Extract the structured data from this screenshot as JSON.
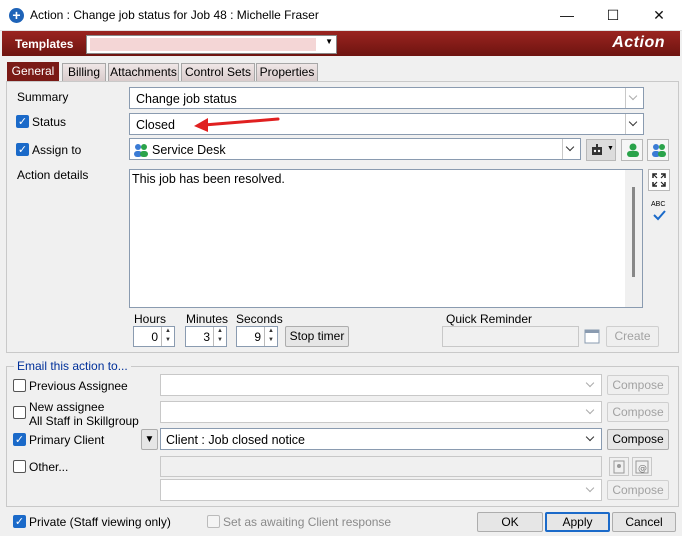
{
  "window": {
    "title": "Action : Change job status for Job 48 : Michelle Fraser",
    "minimize": "—",
    "maximize": "☐",
    "close": "✕"
  },
  "header": {
    "templates_label": "Templates",
    "action_label": "Action"
  },
  "tabs": [
    "General",
    "Billing",
    "Attachments",
    "Control Sets",
    "Properties"
  ],
  "general": {
    "summary_label": "Summary",
    "summary_value": "Change job status",
    "status_label": "Status",
    "status_value": "Closed",
    "assign_label": "Assign to",
    "assign_value": "Service Desk",
    "details_label": "Action details",
    "details_value": "This job has been resolved.",
    "hours_label": "Hours",
    "hours_value": "0",
    "minutes_label": "Minutes",
    "minutes_value": "3",
    "seconds_label": "Seconds",
    "seconds_value": "9",
    "stop_timer": "Stop timer",
    "quick_reminder_label": "Quick Reminder",
    "create_label": "Create",
    "spell_label": "ABC"
  },
  "email": {
    "legend": "Email this action to...",
    "previous_assignee": "Previous Assignee",
    "new_assignee_line1": "New assignee",
    "new_assignee_line2": "All Staff in Skillgroup",
    "primary_client": "Primary Client",
    "primary_client_template": "Client : Job closed notice",
    "other": "Other...",
    "compose": "Compose",
    "filter_glyph": "▼"
  },
  "footer": {
    "private_label": "Private (Staff viewing only)",
    "awaiting_label": "Set as awaiting Client response",
    "ok": "OK",
    "apply": "Apply",
    "cancel": "Cancel"
  },
  "colors": {
    "accent": "#7a1a16",
    "checkbox_blue": "#1b6ac9",
    "arrow_red": "#e02020"
  }
}
